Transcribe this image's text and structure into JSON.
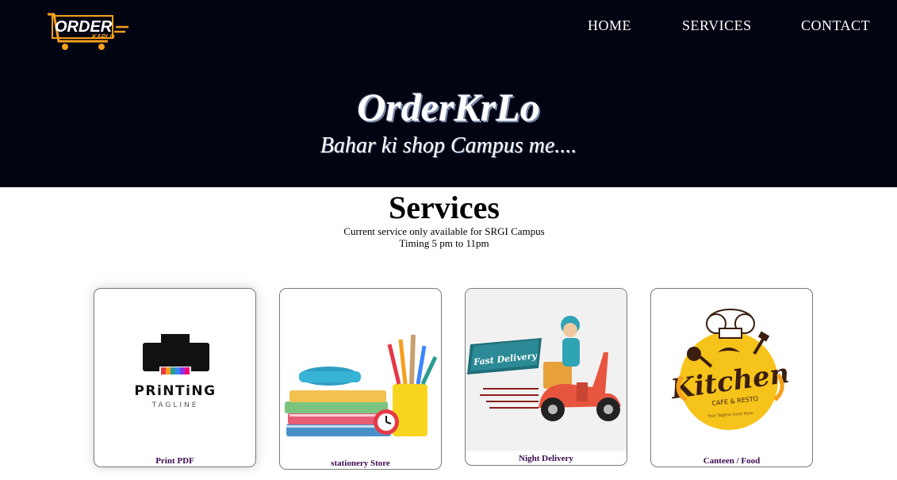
{
  "header": {
    "logo_text_main": "ORDER",
    "logo_text_sub": "KARLO",
    "nav": [
      {
        "label": "HOME"
      },
      {
        "label": "SERVICES"
      },
      {
        "label": "CONTACT"
      }
    ],
    "brand_title": "OrderKrLo",
    "tagline": "Bahar ki shop Campus me...."
  },
  "services": {
    "title": "Services",
    "subtitle_line1": "Current service only available for SRGI Campus",
    "subtitle_line2": "Timing 5 pm to 11pm",
    "cards": [
      {
        "label": "Print PDF",
        "image_text_main": "PRiNTiNG",
        "image_text_sub": "TAGLINE",
        "icon": "printer-icon"
      },
      {
        "label": "stationery Store",
        "icon": "stationery-icon"
      },
      {
        "label": "Night Delivery",
        "image_text_main": "Fast Delivery",
        "icon": "scooter-delivery-icon"
      },
      {
        "label": "Canteen / Food",
        "image_text_main": "Kitchen",
        "image_text_sub": "CAFE & RESTO",
        "image_text_small": "Your Tagline Goes Here",
        "icon": "chef-hat-icon"
      }
    ]
  },
  "colors": {
    "hero_bg": "#020412",
    "accent_orange": "#f4a01c",
    "card_label": "#3b0a4f",
    "kitchen_yellow": "#f6c31a"
  }
}
